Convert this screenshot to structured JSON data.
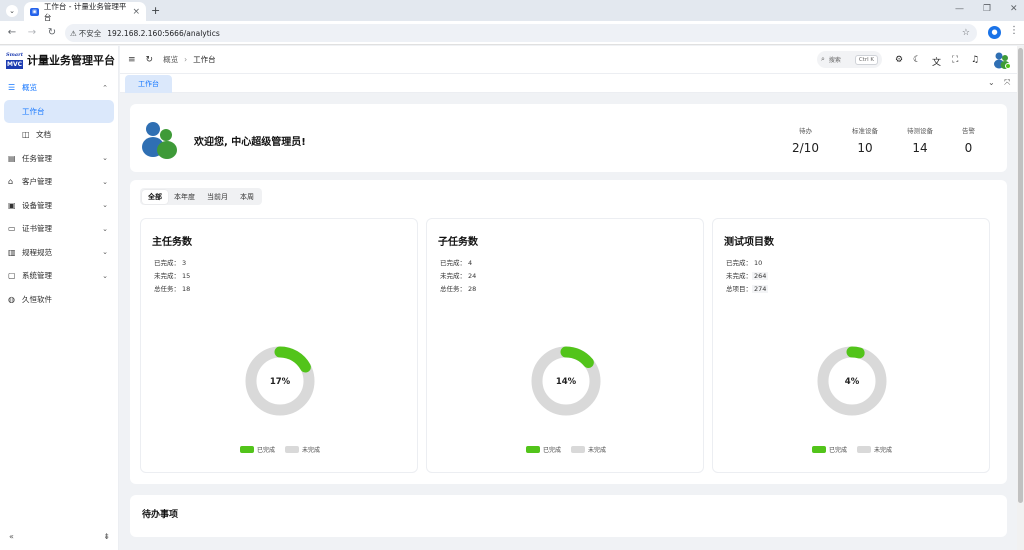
{
  "browser": {
    "tab_title": "工作台 - 计量业务管理平台",
    "insecure_label": "不安全",
    "url": "192.168.2.160:5666/analytics"
  },
  "brand": {
    "logo_top": "Smart",
    "logo_bottom": "MVC",
    "title": "计量业务管理平台"
  },
  "sidebar": {
    "items": [
      {
        "label": "概览",
        "icon": "dashboard-icon"
      },
      {
        "label": "工作台"
      },
      {
        "label": "文档",
        "icon": "book-icon"
      },
      {
        "label": "任务管理",
        "icon": "task-icon"
      },
      {
        "label": "客户管理",
        "icon": "home-icon"
      },
      {
        "label": "设备管理",
        "icon": "device-icon"
      },
      {
        "label": "证书管理",
        "icon": "certificate-icon"
      },
      {
        "label": "规程规范",
        "icon": "chart-icon"
      },
      {
        "label": "系统管理",
        "icon": "settings-icon"
      },
      {
        "label": "久恒软件",
        "icon": "globe-icon"
      }
    ]
  },
  "header": {
    "breadcrumb_root": "概览",
    "breadcrumb_current": "工作台",
    "search_placeholder": "搜索",
    "search_shortcut": "Ctrl K"
  },
  "page_tab": "工作台",
  "welcome": {
    "message": "欢迎您, 中心超级管理员!",
    "stats": [
      {
        "label": "待办",
        "value": "2/10"
      },
      {
        "label": "标准设备",
        "value": "10"
      },
      {
        "label": "待测设备",
        "value": "14"
      },
      {
        "label": "告警",
        "value": "0"
      }
    ]
  },
  "filters": {
    "options": [
      "全部",
      "本年度",
      "当前月",
      "本周"
    ],
    "selected": "全部"
  },
  "cards": [
    {
      "title": "主任务数",
      "rows": [
        [
          "已完成：",
          "3"
        ],
        [
          "未完成：",
          "15"
        ],
        [
          "总任务：",
          "18"
        ]
      ],
      "percent_label": "17%",
      "fraction": 0.17
    },
    {
      "title": "子任务数",
      "rows": [
        [
          "已完成：",
          "4"
        ],
        [
          "未完成：",
          "24"
        ],
        [
          "总任务：",
          "28"
        ]
      ],
      "percent_label": "14%",
      "fraction": 0.14
    },
    {
      "title": "测试项目数",
      "rows": [
        [
          "已完成：",
          "10"
        ],
        [
          "未完成：",
          "264"
        ],
        [
          "总项目：",
          "274"
        ]
      ],
      "percent_label": "4%",
      "fraction": 0.04
    }
  ],
  "legend": {
    "done": "已完成",
    "undone": "未完成"
  },
  "colors": {
    "accent": "#1677ff",
    "done": "#52c41a",
    "undone": "#d9d9d9"
  },
  "todo": {
    "title": "待办事项"
  }
}
